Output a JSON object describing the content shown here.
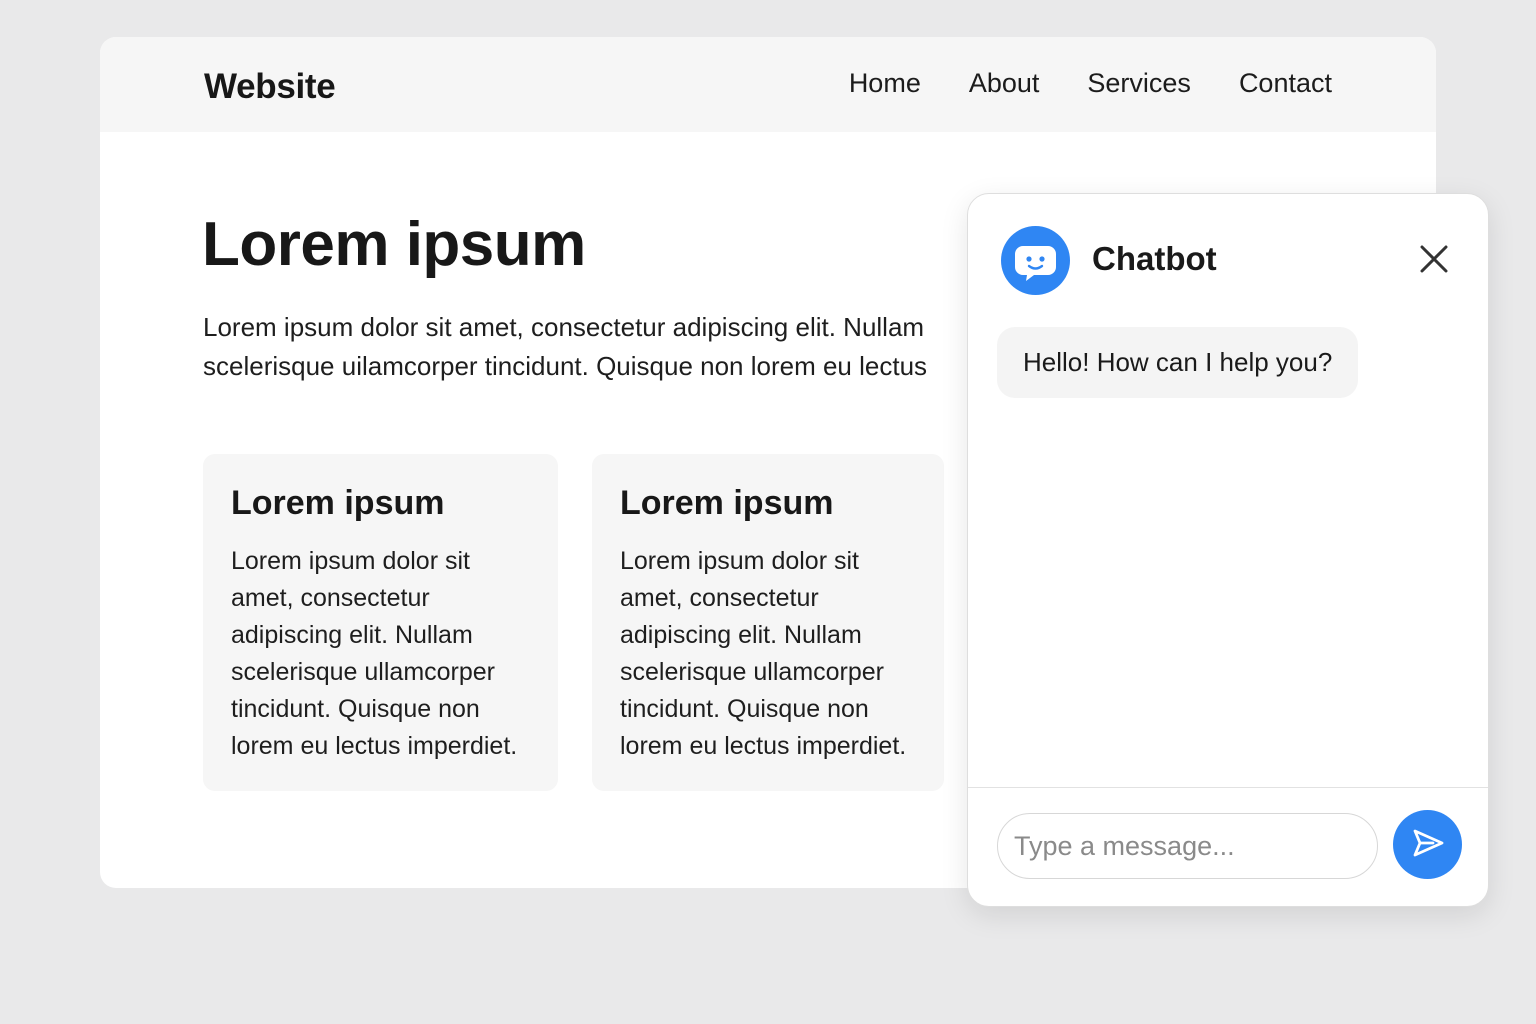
{
  "site": {
    "brand": "Website",
    "nav": [
      "Home",
      "About",
      "Services",
      "Contact"
    ],
    "hero": {
      "title": "Lorem ipsum",
      "text_line1": "Lorem ipsum dolor sit amet, consectetur adipiscing elit. Nullam",
      "text_line2": "scelerisque uilamcorper tincidunt. Quisque non lorem eu lectus"
    },
    "cards": [
      {
        "title": "Lorem ipsum",
        "text": "Lorem ipsum dolor sit amet, consectetur adipiscing elit. Nullam scelerisque ullamcorper tincidunt. Quisque non lorem eu lectus imperdiet."
      },
      {
        "title": "Lorem ipsum",
        "text": "Lorem ipsum dolor sit amet, consectetur adipiscing elit. Nullam scelerisque ullamcorper tincidunt. Quisque non lorem eu lectus imperdiet."
      }
    ]
  },
  "chat": {
    "title": "Chatbot",
    "avatar_icon": "chatbot-face-icon",
    "close_icon": "close-icon",
    "messages": [
      {
        "from": "bot",
        "text": "Hello! How can I help you?"
      }
    ],
    "input_placeholder": "Type a message...",
    "send_icon": "send-icon"
  },
  "colors": {
    "accent": "#2f86f3",
    "page_background": "#e9e9ea",
    "header_background": "#f6f6f6",
    "card_background": "#f6f6f6",
    "bubble_background": "#f4f4f4"
  }
}
